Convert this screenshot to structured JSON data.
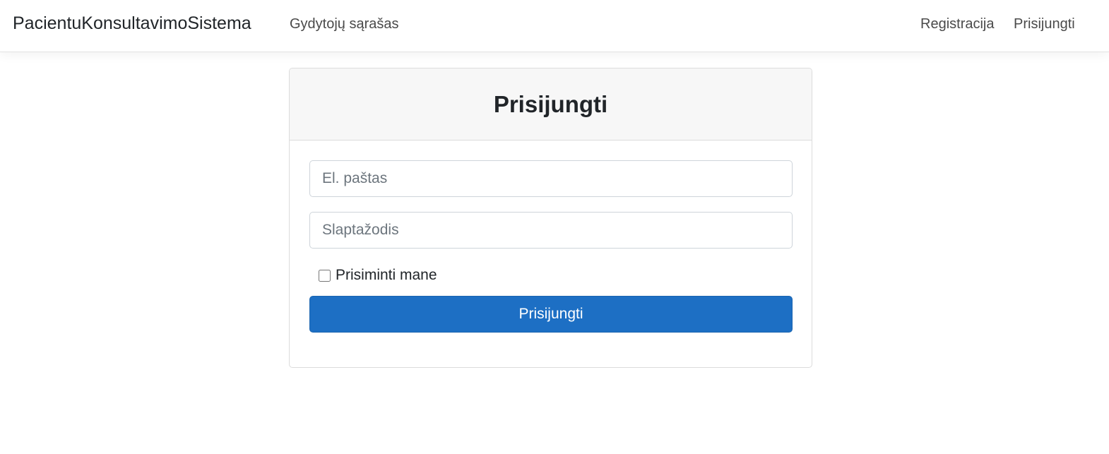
{
  "navbar": {
    "brand": "PacientuKonsultavimoSistema",
    "links": {
      "doctors": "Gydytojų sąrašas",
      "register": "Registracija",
      "login": "Prisijungti"
    }
  },
  "login_card": {
    "title": "Prisijungti",
    "email": {
      "placeholder": "El. paštas",
      "value": ""
    },
    "password": {
      "placeholder": "Slaptažodis",
      "value": ""
    },
    "remember_me": {
      "label": "Prisiminti mane",
      "checked": false
    },
    "submit_label": "Prisijungti"
  },
  "colors": {
    "primary": "#1d6fc4",
    "header_bg": "#f7f7f7",
    "border": "#dcdcdc"
  }
}
